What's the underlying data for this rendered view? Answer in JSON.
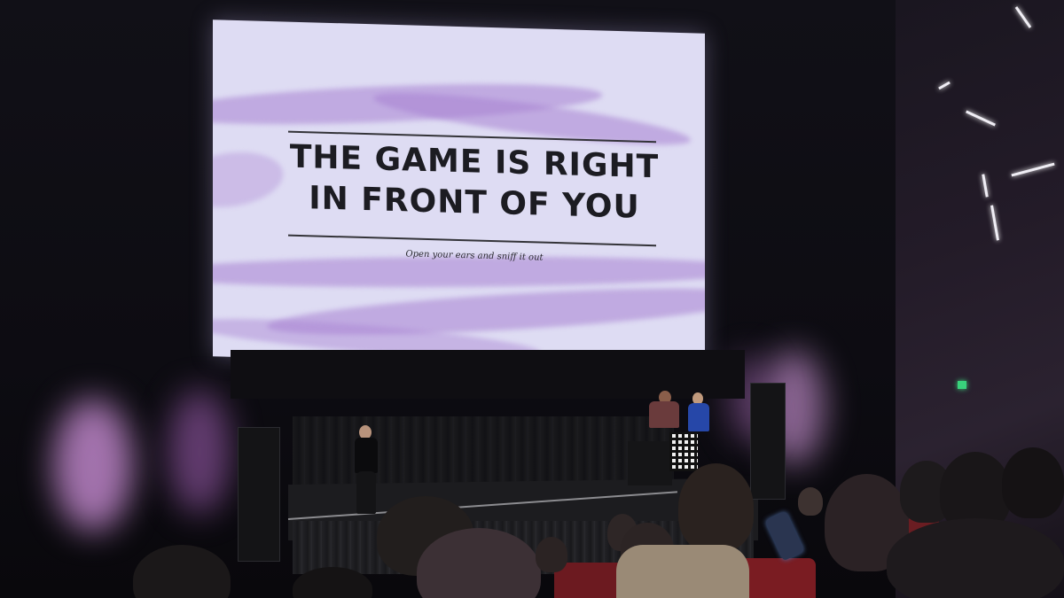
{
  "screen": {
    "title_line1": "THE GAME IS RIGHT",
    "title_line2": "IN FRONT OF YOU",
    "subtitle": "Open your ears and sniff it out"
  },
  "colors": {
    "screen_background": "#dedcf3",
    "screen_swirl": "#a882d2",
    "wall_glow": "#d696e1",
    "seat_red": "#7a1c22",
    "exit_sign": "#39d27c"
  }
}
